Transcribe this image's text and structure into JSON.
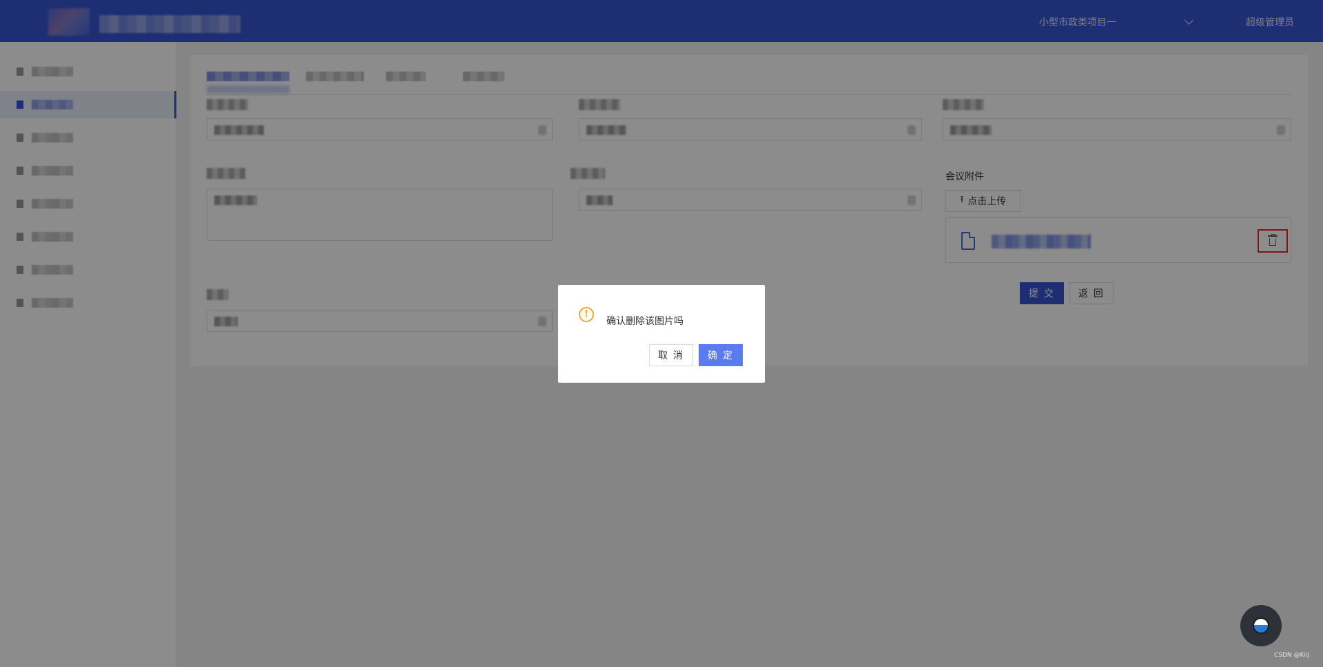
{
  "header": {
    "project_select": "小型市政类项目一",
    "user_name": "超级管理员"
  },
  "form": {
    "attachment_label": "会议附件",
    "upload_button": "点击上传",
    "submit_button": "提 交",
    "back_button": "返 回"
  },
  "dialog": {
    "message": "确认删除该图片吗",
    "cancel_button": "取 消",
    "confirm_button": "确 定",
    "warning_glyph": "!"
  },
  "watermark": "CSDN @KiiJ",
  "colors": {
    "header_bg": "#3554d1",
    "primary": "#3554d1",
    "confirm": "#5b7cf0",
    "warning": "#f5a623",
    "highlight_border": "#ee2222"
  },
  "icons": [
    "chevron-down-icon",
    "upload-icon",
    "file-icon",
    "trash-icon",
    "warning-icon"
  ]
}
